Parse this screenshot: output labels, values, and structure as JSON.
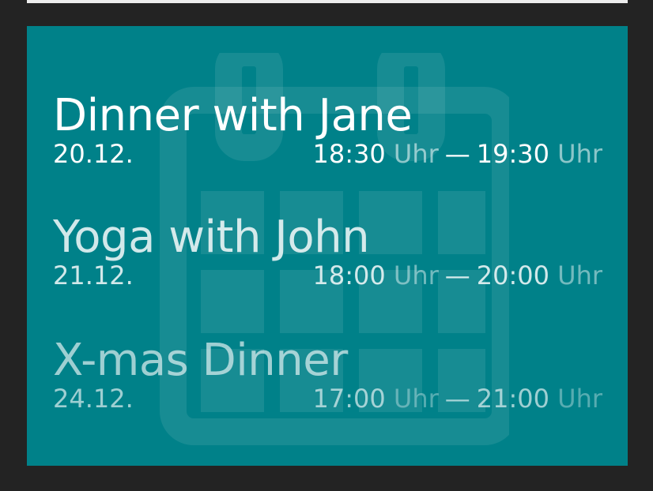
{
  "events": [
    {
      "title": "Dinner with Jane",
      "date": "20.12.",
      "start": "18:30",
      "end": "19:30",
      "unit": "Uhr",
      "dash": "—"
    },
    {
      "title": "Yoga with John",
      "date": "21.12.",
      "start": "18:00",
      "end": "20:00",
      "unit": "Uhr",
      "dash": "—"
    },
    {
      "title": "X-mas Dinner",
      "date": "24.12.",
      "start": "17:00",
      "end": "21:00",
      "unit": "Uhr",
      "dash": "—"
    }
  ],
  "background_icon": "calendar-icon",
  "colors": {
    "frame": "#232323",
    "card": "#008189",
    "text": "#ffffff"
  }
}
